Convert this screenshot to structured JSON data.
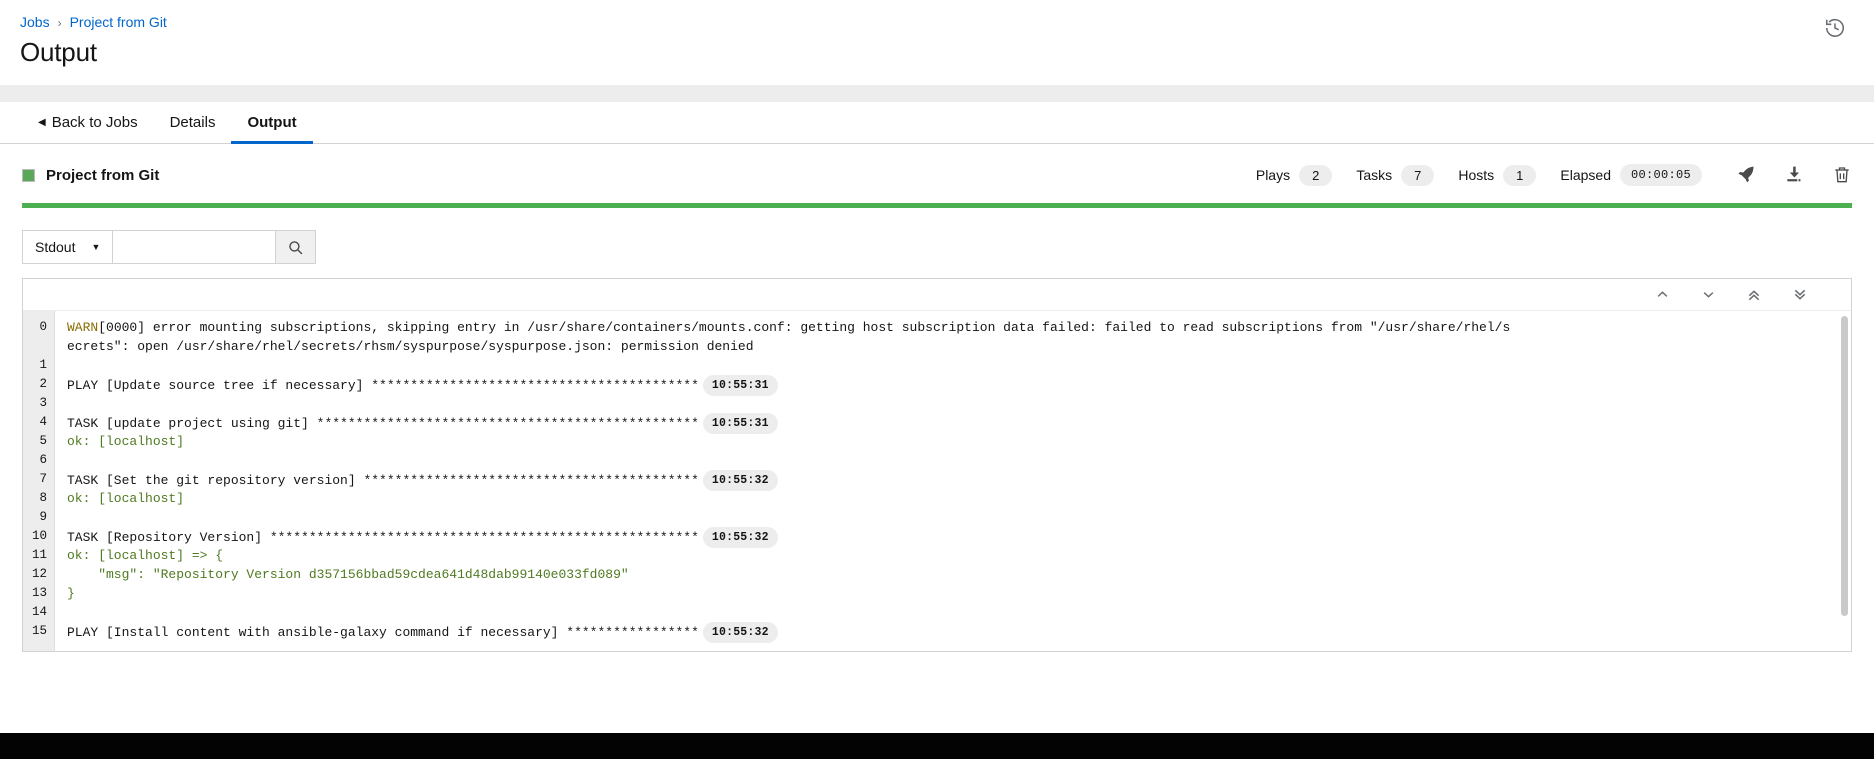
{
  "header": {
    "breadcrumb": {
      "root": "Jobs",
      "separator": "›",
      "current": "Project from Git"
    },
    "title": "Output",
    "history_icon": "history-icon"
  },
  "tabs": [
    {
      "label": "Back to Jobs",
      "active": false,
      "has_back_caret": true
    },
    {
      "label": "Details",
      "active": false
    },
    {
      "label": "Output",
      "active": true
    }
  ],
  "job": {
    "name": "Project from Git",
    "status_color": "#5ba85b",
    "progress_color": "#4caf50",
    "progress_percent": 100,
    "stats": [
      {
        "label": "Plays",
        "value": "2"
      },
      {
        "label": "Tasks",
        "value": "7"
      },
      {
        "label": "Hosts",
        "value": "1"
      },
      {
        "label": "Elapsed",
        "value": "00:00:05"
      }
    ],
    "actions": [
      {
        "name": "relaunch-icon",
        "title": "Relaunch"
      },
      {
        "name": "download-icon",
        "title": "Download Output"
      },
      {
        "name": "delete-icon",
        "title": "Delete Job"
      }
    ]
  },
  "toolbar": {
    "filter_select": "Stdout",
    "search_value": "",
    "search_placeholder": "",
    "search_button_icon": "search-icon"
  },
  "console": {
    "nav_buttons": [
      {
        "name": "scroll-previous-icon",
        "glyph": "∧"
      },
      {
        "name": "scroll-next-icon",
        "glyph": "∨"
      },
      {
        "name": "scroll-first-icon",
        "glyph": "«"
      },
      {
        "name": "scroll-last-icon",
        "glyph": "»"
      }
    ],
    "lines": [
      {
        "num": "0",
        "wrapped": true,
        "segments": [
          {
            "text": "WARN",
            "style": "warn"
          },
          {
            "text": "[0000] error mounting subscriptions, skipping entry in /usr/share/containers/mounts.conf: getting host subscription data failed: failed to read subscriptions from \"/usr/share/rhel/s",
            "style": "plain"
          }
        ],
        "wrap_text": "ecrets\": open /usr/share/rhel/secrets/rhsm/syspurpose/syspurpose.json: permission denied"
      },
      {
        "num": "1",
        "segments": []
      },
      {
        "num": "2",
        "segments": [
          {
            "text": "PLAY [Update source tree if necessary] ******************************************",
            "style": "plain"
          }
        ],
        "timestamp": "10:55:31"
      },
      {
        "num": "3",
        "segments": []
      },
      {
        "num": "4",
        "segments": [
          {
            "text": "TASK [update project using git] *************************************************",
            "style": "plain"
          }
        ],
        "timestamp": "10:55:31"
      },
      {
        "num": "5",
        "segments": [
          {
            "text": "ok: [localhost]",
            "style": "ok"
          }
        ]
      },
      {
        "num": "6",
        "segments": []
      },
      {
        "num": "7",
        "segments": [
          {
            "text": "TASK [Set the git repository version] *******************************************",
            "style": "plain"
          }
        ],
        "timestamp": "10:55:32"
      },
      {
        "num": "8",
        "segments": [
          {
            "text": "ok: [localhost]",
            "style": "ok"
          }
        ]
      },
      {
        "num": "9",
        "segments": []
      },
      {
        "num": "10",
        "segments": [
          {
            "text": "TASK [Repository Version] *******************************************************",
            "style": "plain"
          }
        ],
        "timestamp": "10:55:32"
      },
      {
        "num": "11",
        "segments": [
          {
            "text": "ok: [localhost] => {",
            "style": "ok"
          }
        ]
      },
      {
        "num": "12",
        "segments": [
          {
            "text": "    \"msg\": \"Repository Version d357156bbad59cdea641d48dab99140e033fd089\"",
            "style": "ok"
          }
        ]
      },
      {
        "num": "13",
        "segments": [
          {
            "text": "}",
            "style": "ok"
          }
        ]
      },
      {
        "num": "14",
        "segments": []
      },
      {
        "num": "15",
        "segments": [
          {
            "text": "PLAY [Install content with ansible-galaxy command if necessary] *****************",
            "style": "plain"
          }
        ],
        "timestamp": "10:55:32"
      }
    ]
  }
}
